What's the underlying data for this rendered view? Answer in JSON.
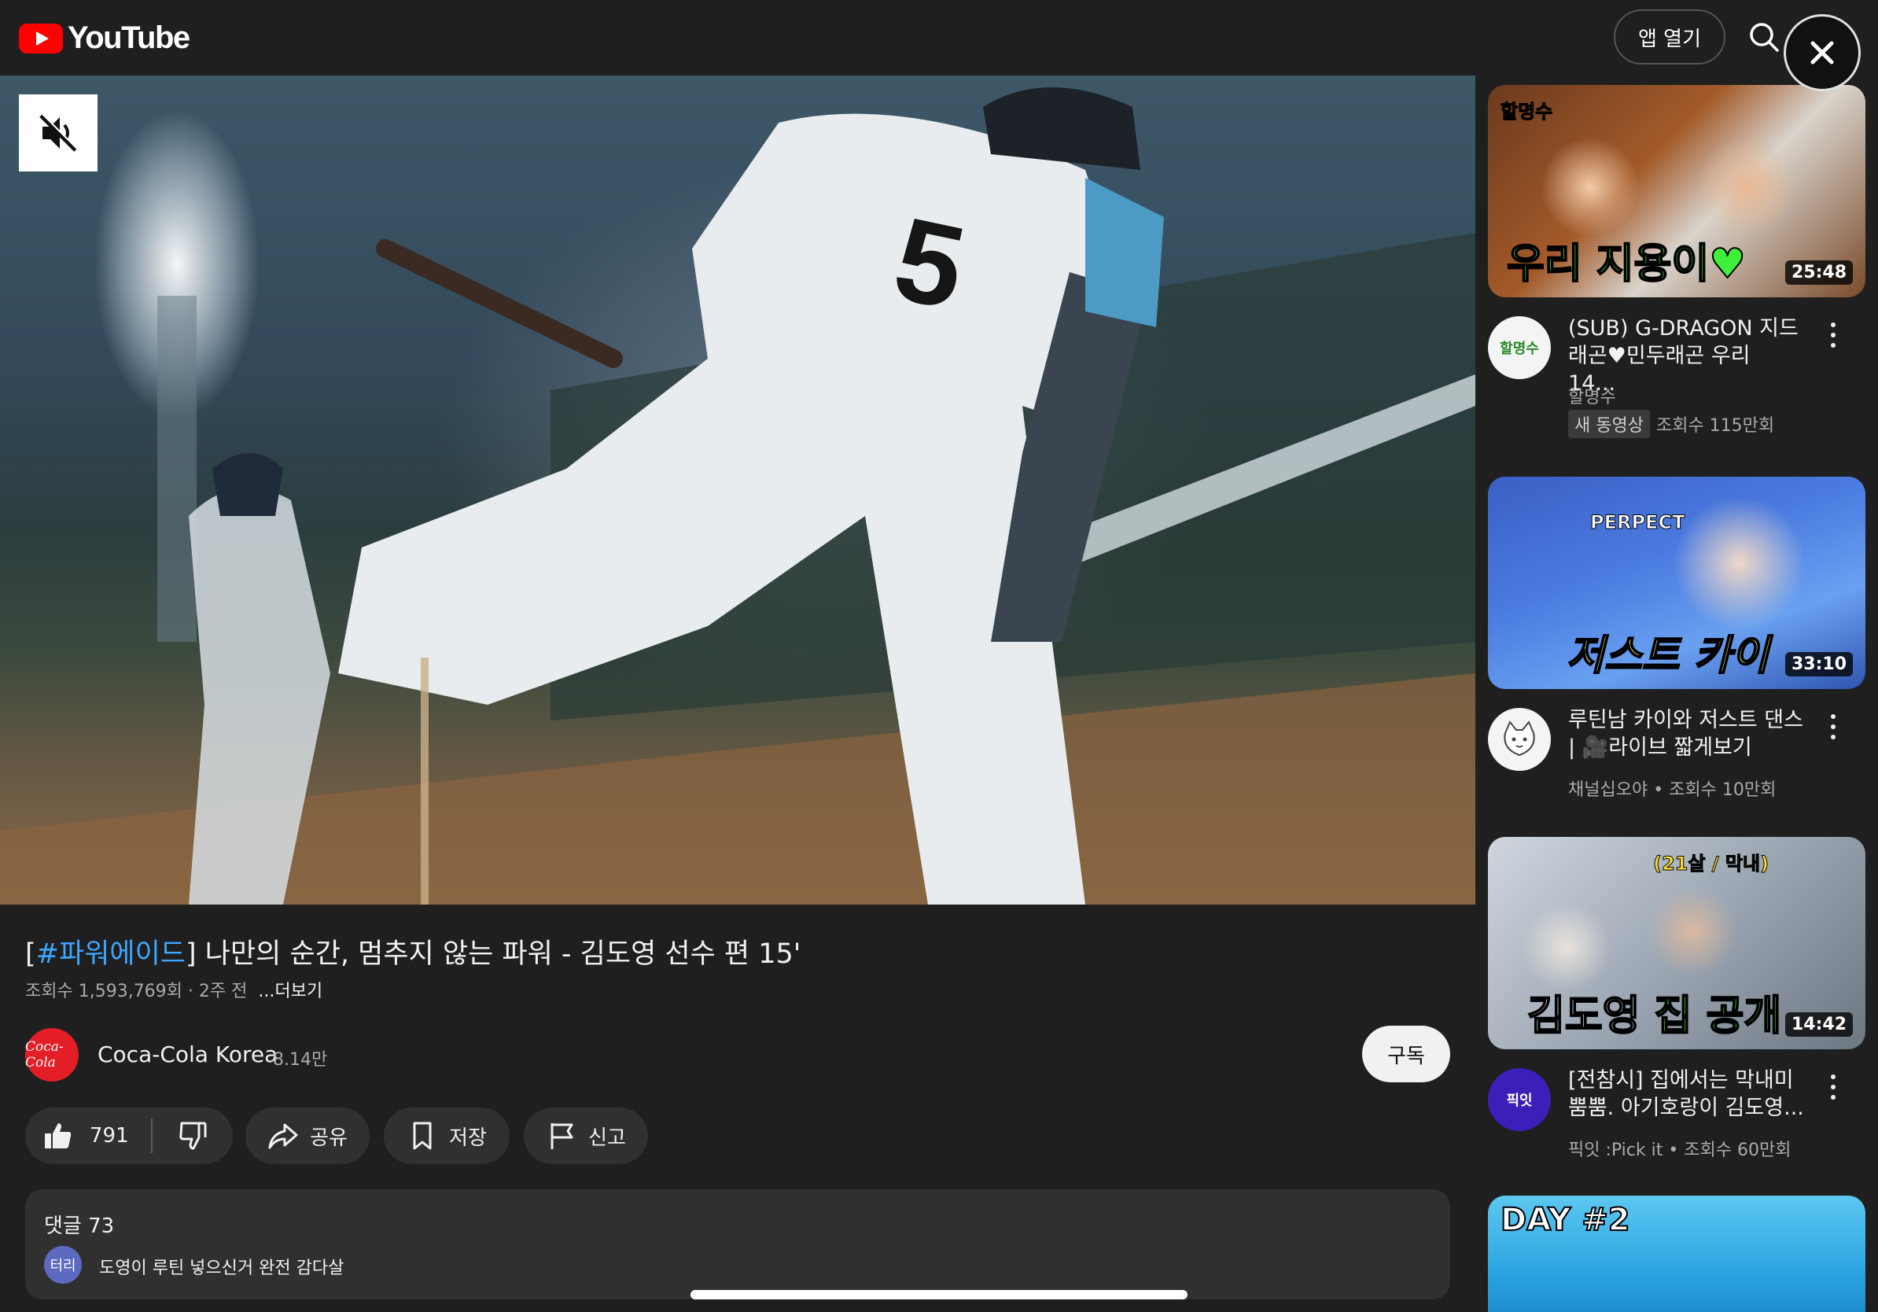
{
  "header": {
    "logo_text": "YouTube",
    "open_app_label": "앱 열기"
  },
  "video": {
    "title_hashtag": "#파워에이드",
    "title_rest": " 나만의 순간, 멈추지 않는 파워 - 김도영 선수 편 15'",
    "meta": "조회수 1,593,769회 · 2주 전",
    "more_label": "...더보기",
    "muted": true
  },
  "channel": {
    "avatar_text": "Coca-Cola",
    "name": "Coca-Cola Korea",
    "subscribers": "8.14만",
    "subscribe_label": "구독"
  },
  "actions": {
    "like_count": "791",
    "share_label": "공유",
    "save_label": "저장",
    "report_label": "신고"
  },
  "comments": {
    "header": "댓글 73",
    "top_author_avatar": "터리",
    "top_comment": "도영이 루틴 넣으신거 완전 감다살"
  },
  "sidebar": [
    {
      "thumb_tag": "할명수",
      "thumb_text": "우리 지용이♥",
      "duration": "25:48",
      "avatar_text": "할명수",
      "title": "(SUB) G-DRAGON 지드래곤♥민두래곤 우리 14...",
      "channel": "할명수",
      "badge": "새 동영상",
      "views": "조회수 115만회"
    },
    {
      "thumb_tag": "PERPECT",
      "thumb_text": "저스트 카이",
      "duration": "33:10",
      "avatar_text": "",
      "title": "루틴남 카이와 저스트 댄스 | 🎥라이브 짧게보기",
      "meta": "채널십오야 • 조회수 10만회"
    },
    {
      "thumb_tag": "(21살 / 막내)",
      "thumb_text_a": "김도영 ",
      "thumb_text_b": "집 공개",
      "duration": "14:42",
      "avatar_text": "픽잇",
      "title": "[전참시] 집에서는 막내미 뿜뿜. 아기호랑이 김도영...",
      "meta": "픽잇 :Pick it • 조회수 60만회"
    },
    {
      "thumb_tag": "DAY #2"
    }
  ],
  "colors": {
    "background": "#1f1f1f",
    "surface": "#303030",
    "brand_red": "#ff0000",
    "link_blue": "#3ea6ff"
  }
}
